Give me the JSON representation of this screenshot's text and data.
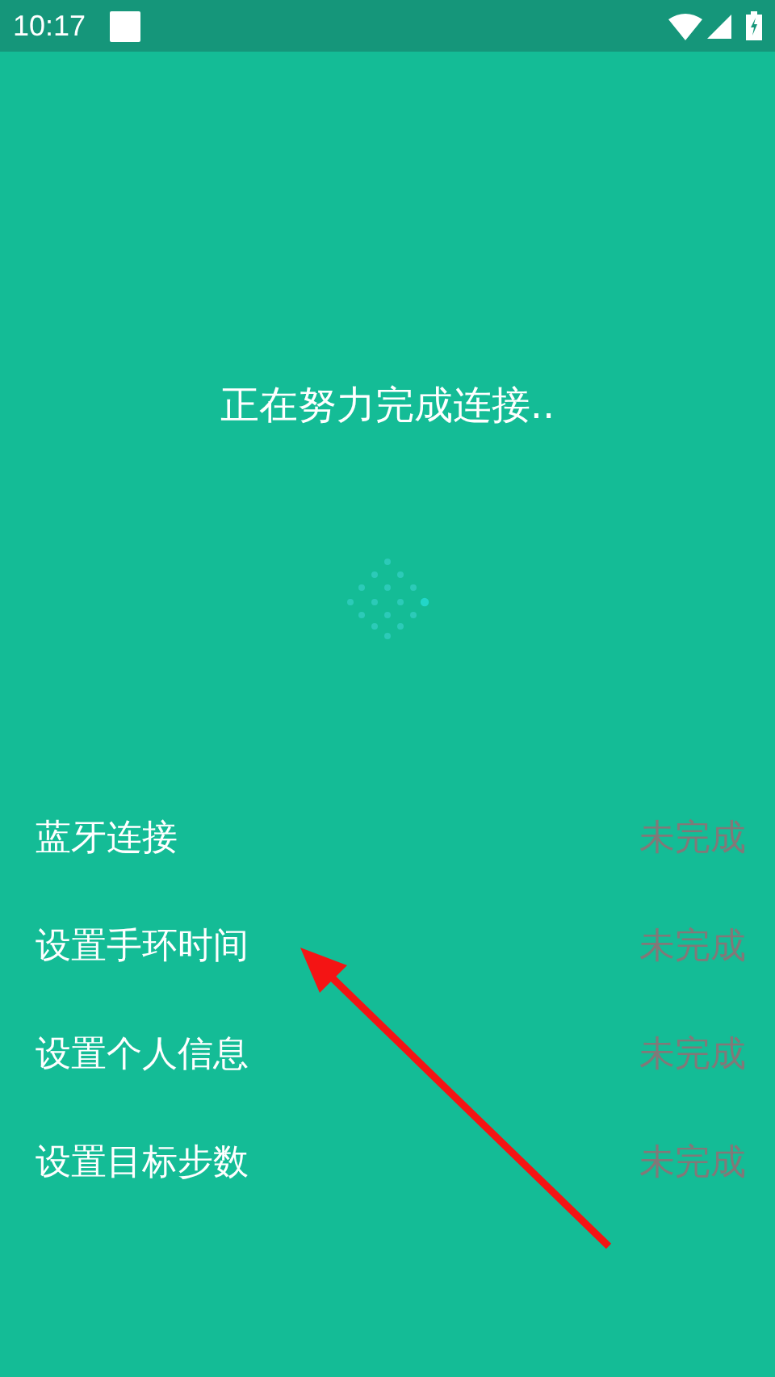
{
  "status_bar": {
    "time": "10:17"
  },
  "message": "正在努力完成连接..",
  "steps": [
    {
      "label": "蓝牙连接",
      "status": "未完成",
      "done": false
    },
    {
      "label": "设置手环时间",
      "status": "未完成",
      "done": false
    },
    {
      "label": "设置个人信息",
      "status": "未完成",
      "done": false
    },
    {
      "label": "设置目标步数",
      "status": "未完成",
      "done": false
    }
  ]
}
